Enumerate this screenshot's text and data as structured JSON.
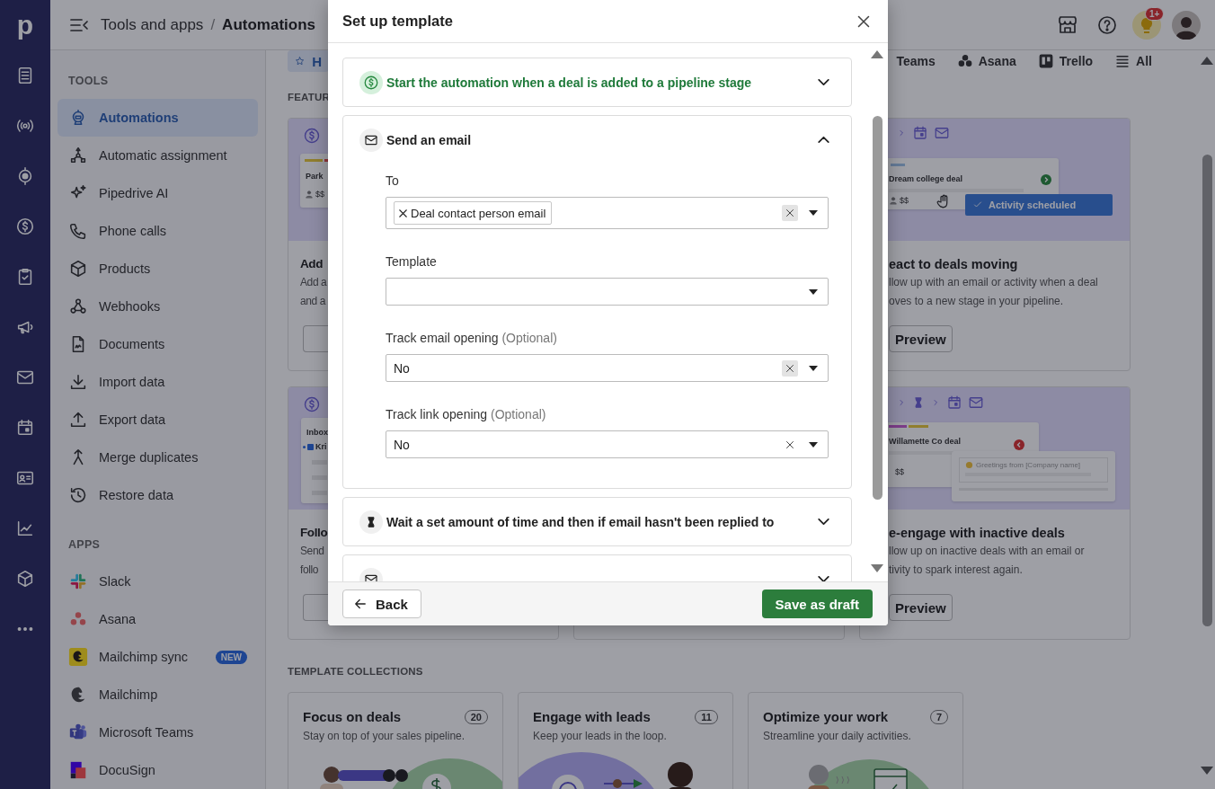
{
  "rail": {
    "logo": "p"
  },
  "topbar": {
    "breadcrumb_parent": "Tools and apps",
    "breadcrumb_separator": "/",
    "breadcrumb_current": "Automations",
    "notification_badge": "1+"
  },
  "sidebar": {
    "sections": [
      {
        "heading": "TOOLS",
        "items": [
          {
            "label": "Automations",
            "selected": true
          },
          {
            "label": "Automatic assignment",
            "selected": false
          },
          {
            "label": "Pipedrive AI",
            "selected": false
          },
          {
            "label": "Phone calls",
            "selected": false
          },
          {
            "label": "Products",
            "selected": false
          },
          {
            "label": "Webhooks",
            "selected": false
          },
          {
            "label": "Documents",
            "selected": false
          },
          {
            "label": "Import data",
            "selected": false
          },
          {
            "label": "Export data",
            "selected": false
          },
          {
            "label": "Merge duplicates",
            "selected": false
          },
          {
            "label": "Restore data",
            "selected": false
          }
        ]
      },
      {
        "heading": "APPS",
        "items": [
          {
            "label": "Slack",
            "selected": false
          },
          {
            "label": "Asana",
            "selected": false
          },
          {
            "label": "Mailchimp sync",
            "selected": false,
            "badge": "NEW"
          },
          {
            "label": "Mailchimp",
            "selected": false
          },
          {
            "label": "Microsoft Teams",
            "selected": false
          },
          {
            "label": "DocuSign",
            "selected": false
          }
        ]
      }
    ]
  },
  "main": {
    "tabs": [
      {
        "label": "H",
        "selected": true
      },
      {
        "label": "Teams",
        "selected": false
      },
      {
        "label": "Asana",
        "selected": false
      },
      {
        "label": "Trello",
        "selected": false
      },
      {
        "label": "All",
        "selected": false
      }
    ],
    "featured_heading": "FEATUR",
    "featured_cards": [
      {
        "kind": "deal",
        "deal_name": "Park",
        "deal_value": "$$",
        "title": "Add",
        "description_lines": [
          "Add a",
          "and a"
        ]
      },
      {
        "kind": "deal_activity",
        "deal_name": "Dream college deal",
        "deal_value": "$$",
        "toast": "Activity scheduled",
        "title": "eact to deals moving",
        "description_lines": [
          "llow up with an email or activity when a deal",
          "oves to a new stage in your pipeline."
        ],
        "button": "Preview"
      },
      {
        "kind": "inbox",
        "inbox_title": "Inbox",
        "sender": "Kri",
        "title": "Follo",
        "description_lines": [
          "Send",
          "follo"
        ]
      },
      {
        "kind": "deal_email",
        "deal_name": "Willamette Co deal",
        "deal_value": "$$",
        "email_greeting": "Greetings from [Company name]",
        "title": "e-engage with inactive deals",
        "description_lines": [
          "llow up on inactive deals with an email or",
          "tivity to spark interest again."
        ],
        "button": "Preview"
      }
    ],
    "collections_heading": "TEMPLATE COLLECTIONS",
    "collections": [
      {
        "kind": "deals",
        "title": "Focus on deals",
        "count": "20",
        "subtitle": "Stay on top of your sales pipeline."
      },
      {
        "kind": "leads",
        "title": "Engage with leads",
        "count": "11",
        "subtitle": "Keep your leads in the loop."
      },
      {
        "kind": "work",
        "title": "Optimize your work",
        "count": "7",
        "subtitle": "Streamline your daily activities."
      }
    ]
  },
  "modal": {
    "title": "Set up template",
    "steps": [
      {
        "kind": "trigger",
        "title": "Start the automation when a deal is added to a pipeline stage",
        "expanded": false
      },
      {
        "kind": "email",
        "title": "Send an email",
        "expanded": true,
        "fields": [
          {
            "kind": "tags",
            "label": "To",
            "tags": [
              "Deal contact person email"
            ],
            "clear_highlighted": true
          },
          {
            "kind": "select",
            "label": "Template"
          },
          {
            "kind": "select",
            "label": "Track email opening",
            "optional_note": "(Optional)",
            "value": "No",
            "clear_highlighted": true
          },
          {
            "kind": "select",
            "label": "Track link opening",
            "optional_note": "(Optional)",
            "value": "No",
            "clear_highlighted": false
          }
        ]
      },
      {
        "kind": "wait",
        "title": "Wait a set amount of time and then if email hasn't been replied to",
        "expanded": false
      },
      {
        "kind": "email",
        "expanded": false
      }
    ],
    "back_button": "Back",
    "save_button": "Save as draft"
  }
}
